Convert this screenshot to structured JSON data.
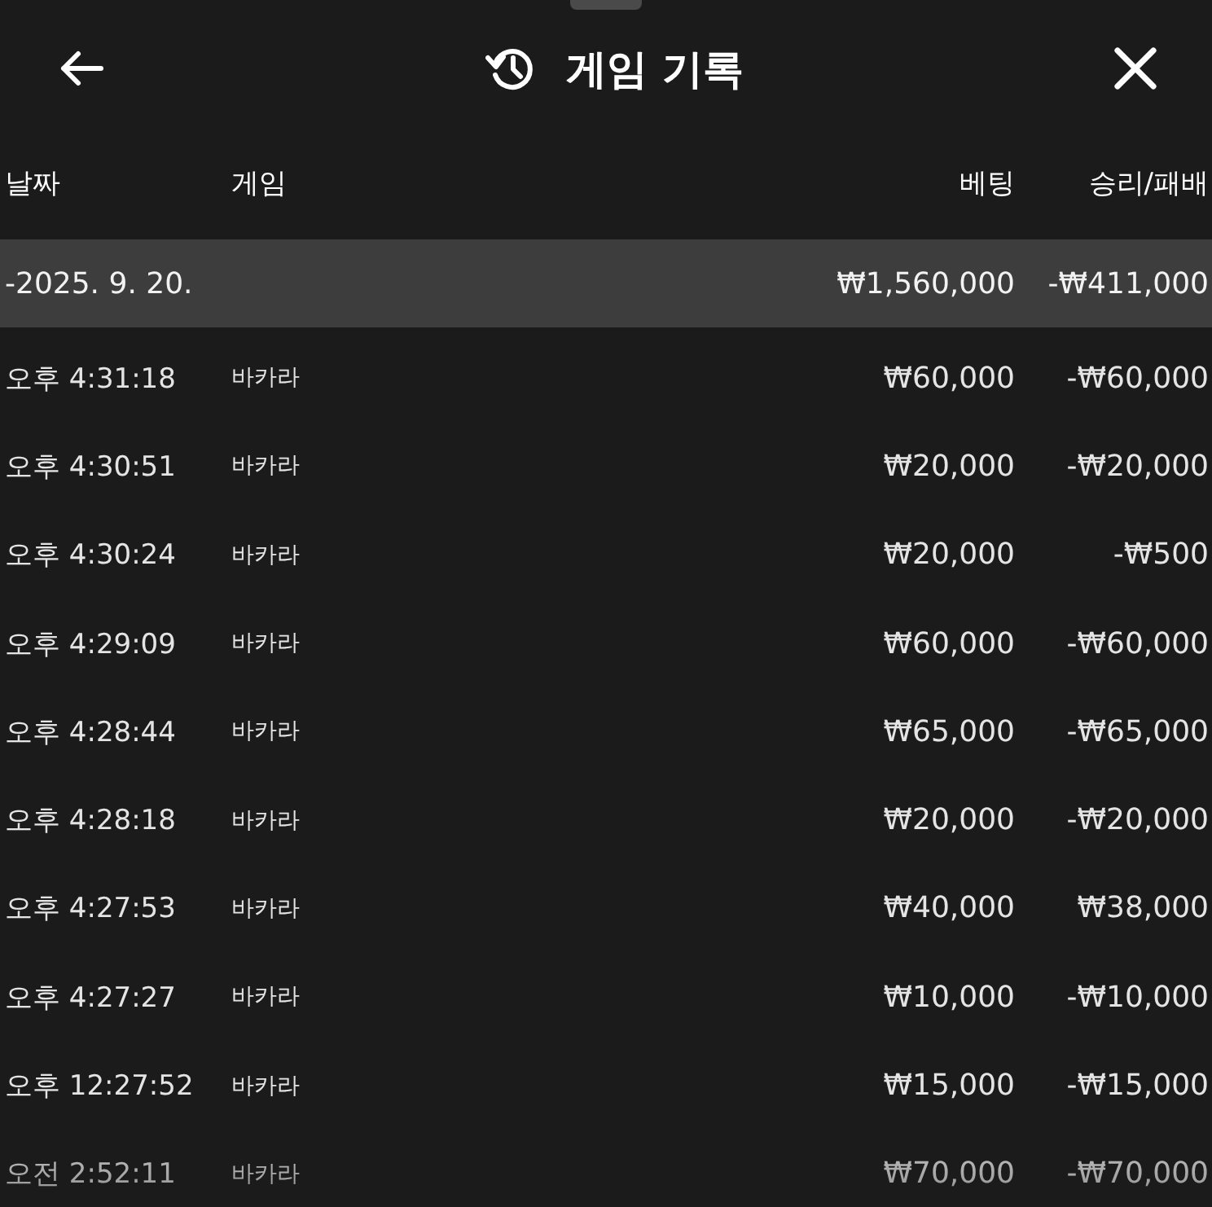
{
  "window": {
    "title": "게임 기록"
  },
  "table": {
    "columns": [
      "날짜",
      "게임",
      "베팅",
      "승리/패배"
    ],
    "groups": [
      {
        "date": "-2025. 9. 20.",
        "total_bet": "₩1,560,000",
        "total_result": "-₩411,000",
        "rows": [
          {
            "time": "오후 4:31:18",
            "game": "바카라",
            "bet": "₩60,000",
            "result": "-₩60,000"
          },
          {
            "time": "오후 4:30:51",
            "game": "바카라",
            "bet": "₩20,000",
            "result": "-₩20,000"
          },
          {
            "time": "오후 4:30:24",
            "game": "바카라",
            "bet": "₩20,000",
            "result": "-₩500"
          },
          {
            "time": "오후 4:29:09",
            "game": "바카라",
            "bet": "₩60,000",
            "result": "-₩60,000"
          },
          {
            "time": "오후 4:28:44",
            "game": "바카라",
            "bet": "₩65,000",
            "result": "-₩65,000"
          },
          {
            "time": "오후 4:28:18",
            "game": "바카라",
            "bet": "₩20,000",
            "result": "-₩20,000"
          },
          {
            "time": "오후 4:27:53",
            "game": "바카라",
            "bet": "₩40,000",
            "result": "₩38,000"
          },
          {
            "time": "오후 4:27:27",
            "game": "바카라",
            "bet": "₩10,000",
            "result": "-₩10,000"
          },
          {
            "time": "오후 12:27:52",
            "game": "바카라",
            "bet": "₩15,000",
            "result": "-₩15,000"
          },
          {
            "time": "오전 2:52:11",
            "game": "바카라",
            "bet": "₩70,000",
            "result": "-₩70,000"
          }
        ]
      }
    ]
  }
}
